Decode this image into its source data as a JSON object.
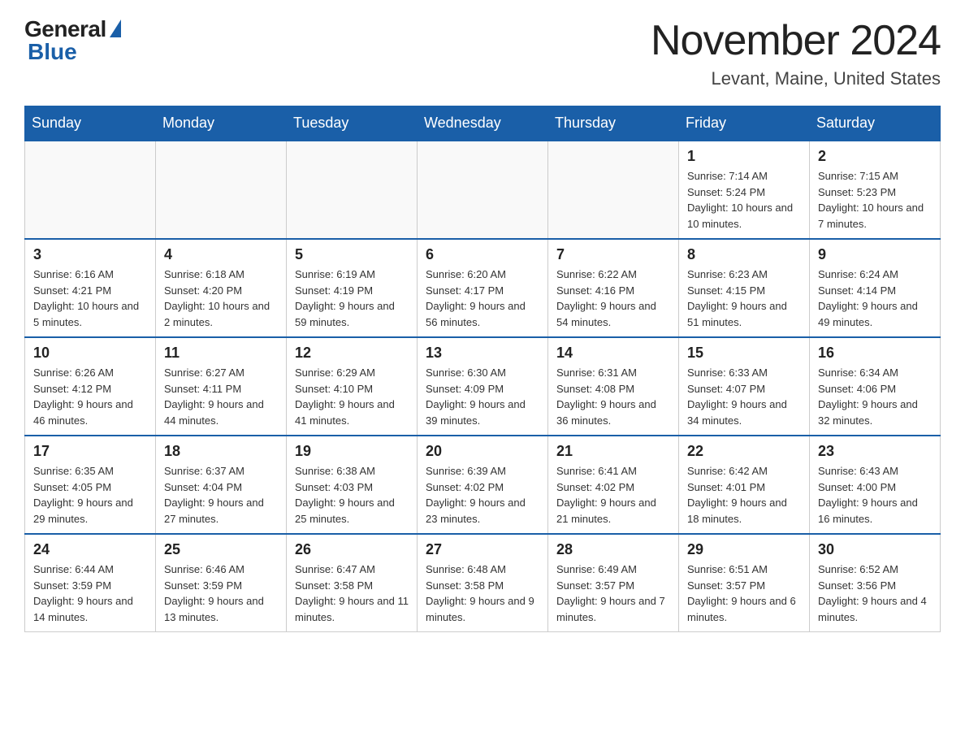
{
  "header": {
    "logo_general": "General",
    "logo_blue": "Blue",
    "month_title": "November 2024",
    "location": "Levant, Maine, United States"
  },
  "weekdays": [
    "Sunday",
    "Monday",
    "Tuesday",
    "Wednesday",
    "Thursday",
    "Friday",
    "Saturday"
  ],
  "weeks": [
    [
      {
        "day": "",
        "info": ""
      },
      {
        "day": "",
        "info": ""
      },
      {
        "day": "",
        "info": ""
      },
      {
        "day": "",
        "info": ""
      },
      {
        "day": "",
        "info": ""
      },
      {
        "day": "1",
        "info": "Sunrise: 7:14 AM\nSunset: 5:24 PM\nDaylight: 10 hours and 10 minutes."
      },
      {
        "day": "2",
        "info": "Sunrise: 7:15 AM\nSunset: 5:23 PM\nDaylight: 10 hours and 7 minutes."
      }
    ],
    [
      {
        "day": "3",
        "info": "Sunrise: 6:16 AM\nSunset: 4:21 PM\nDaylight: 10 hours and 5 minutes."
      },
      {
        "day": "4",
        "info": "Sunrise: 6:18 AM\nSunset: 4:20 PM\nDaylight: 10 hours and 2 minutes."
      },
      {
        "day": "5",
        "info": "Sunrise: 6:19 AM\nSunset: 4:19 PM\nDaylight: 9 hours and 59 minutes."
      },
      {
        "day": "6",
        "info": "Sunrise: 6:20 AM\nSunset: 4:17 PM\nDaylight: 9 hours and 56 minutes."
      },
      {
        "day": "7",
        "info": "Sunrise: 6:22 AM\nSunset: 4:16 PM\nDaylight: 9 hours and 54 minutes."
      },
      {
        "day": "8",
        "info": "Sunrise: 6:23 AM\nSunset: 4:15 PM\nDaylight: 9 hours and 51 minutes."
      },
      {
        "day": "9",
        "info": "Sunrise: 6:24 AM\nSunset: 4:14 PM\nDaylight: 9 hours and 49 minutes."
      }
    ],
    [
      {
        "day": "10",
        "info": "Sunrise: 6:26 AM\nSunset: 4:12 PM\nDaylight: 9 hours and 46 minutes."
      },
      {
        "day": "11",
        "info": "Sunrise: 6:27 AM\nSunset: 4:11 PM\nDaylight: 9 hours and 44 minutes."
      },
      {
        "day": "12",
        "info": "Sunrise: 6:29 AM\nSunset: 4:10 PM\nDaylight: 9 hours and 41 minutes."
      },
      {
        "day": "13",
        "info": "Sunrise: 6:30 AM\nSunset: 4:09 PM\nDaylight: 9 hours and 39 minutes."
      },
      {
        "day": "14",
        "info": "Sunrise: 6:31 AM\nSunset: 4:08 PM\nDaylight: 9 hours and 36 minutes."
      },
      {
        "day": "15",
        "info": "Sunrise: 6:33 AM\nSunset: 4:07 PM\nDaylight: 9 hours and 34 minutes."
      },
      {
        "day": "16",
        "info": "Sunrise: 6:34 AM\nSunset: 4:06 PM\nDaylight: 9 hours and 32 minutes."
      }
    ],
    [
      {
        "day": "17",
        "info": "Sunrise: 6:35 AM\nSunset: 4:05 PM\nDaylight: 9 hours and 29 minutes."
      },
      {
        "day": "18",
        "info": "Sunrise: 6:37 AM\nSunset: 4:04 PM\nDaylight: 9 hours and 27 minutes."
      },
      {
        "day": "19",
        "info": "Sunrise: 6:38 AM\nSunset: 4:03 PM\nDaylight: 9 hours and 25 minutes."
      },
      {
        "day": "20",
        "info": "Sunrise: 6:39 AM\nSunset: 4:02 PM\nDaylight: 9 hours and 23 minutes."
      },
      {
        "day": "21",
        "info": "Sunrise: 6:41 AM\nSunset: 4:02 PM\nDaylight: 9 hours and 21 minutes."
      },
      {
        "day": "22",
        "info": "Sunrise: 6:42 AM\nSunset: 4:01 PM\nDaylight: 9 hours and 18 minutes."
      },
      {
        "day": "23",
        "info": "Sunrise: 6:43 AM\nSunset: 4:00 PM\nDaylight: 9 hours and 16 minutes."
      }
    ],
    [
      {
        "day": "24",
        "info": "Sunrise: 6:44 AM\nSunset: 3:59 PM\nDaylight: 9 hours and 14 minutes."
      },
      {
        "day": "25",
        "info": "Sunrise: 6:46 AM\nSunset: 3:59 PM\nDaylight: 9 hours and 13 minutes."
      },
      {
        "day": "26",
        "info": "Sunrise: 6:47 AM\nSunset: 3:58 PM\nDaylight: 9 hours and 11 minutes."
      },
      {
        "day": "27",
        "info": "Sunrise: 6:48 AM\nSunset: 3:58 PM\nDaylight: 9 hours and 9 minutes."
      },
      {
        "day": "28",
        "info": "Sunrise: 6:49 AM\nSunset: 3:57 PM\nDaylight: 9 hours and 7 minutes."
      },
      {
        "day": "29",
        "info": "Sunrise: 6:51 AM\nSunset: 3:57 PM\nDaylight: 9 hours and 6 minutes."
      },
      {
        "day": "30",
        "info": "Sunrise: 6:52 AM\nSunset: 3:56 PM\nDaylight: 9 hours and 4 minutes."
      }
    ]
  ]
}
